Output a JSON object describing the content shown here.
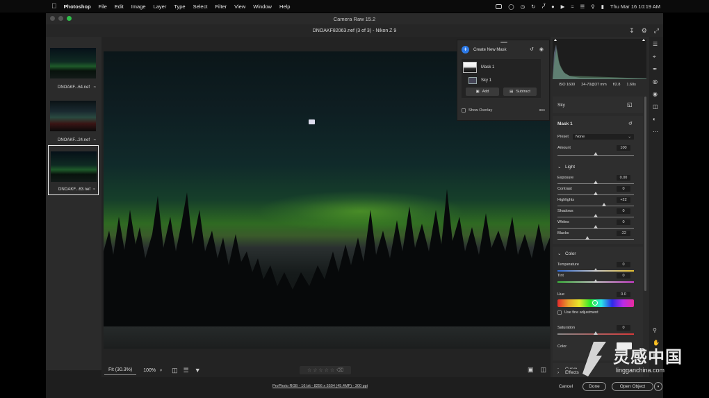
{
  "menubar": {
    "app": "Photoshop",
    "items": [
      "File",
      "Edit",
      "Image",
      "Layer",
      "Type",
      "Select",
      "Filter",
      "View",
      "Window",
      "Help"
    ],
    "datetime": "Thu Mar 16  10:19 AM"
  },
  "window": {
    "title": "Camera Raw 15.2",
    "file_title": "DNOAKF82063.nef (3 of 3)  -  Nikon Z 9"
  },
  "filmstrip": [
    {
      "name": "DNOAKF...64.nef",
      "stack": "≈"
    },
    {
      "name": "DNOAKF...24.nef",
      "stack": "≈"
    },
    {
      "name": "DNOAKF...63.nef",
      "stack": "≈"
    }
  ],
  "mask_panel": {
    "create_label": "Create New Mask",
    "mask_name": "Mask 1",
    "sub_name": "Sky 1",
    "add_label": "Add",
    "subtract_label": "Subtract",
    "overlay_label": "Show Overlay"
  },
  "toolbar": {
    "fit_label": "Fit (30.3%)",
    "zoom_label": "100%",
    "rating": "☆ ☆ ☆ ☆ ☆"
  },
  "status": {
    "info": "ProPhoto RGB - 16 bit - 8256 x 5504 (45.4MP) - 300 ppi"
  },
  "camera": {
    "iso": "ISO 1600",
    "lens": "24-70@37 mm",
    "aperture": "f/2.8",
    "shutter": "1.60s"
  },
  "panel": {
    "sky_label": "Sky",
    "mask_title": "Mask 1",
    "preset_label": "Preset",
    "preset_value": "None",
    "amount_label": "Amount",
    "amount_value": "100",
    "light_title": "Light",
    "light": [
      {
        "label": "Exposure",
        "value": "0.00",
        "pos": 0.5
      },
      {
        "label": "Contrast",
        "value": "0",
        "pos": 0.5
      },
      {
        "label": "Highlights",
        "value": "+22",
        "pos": 0.61
      },
      {
        "label": "Shadows",
        "value": "0",
        "pos": 0.5
      },
      {
        "label": "Whites",
        "value": "0",
        "pos": 0.5
      },
      {
        "label": "Blacks",
        "value": "-22",
        "pos": 0.39
      }
    ],
    "color_title": "Color",
    "temperature_label": "Temperature",
    "temperature_value": "0",
    "tint_label": "Tint",
    "tint_value": "0",
    "hue_label": "Hue",
    "hue_value": "0.0",
    "fine_label": "Use fine adjustment",
    "saturation_label": "Saturation",
    "saturation_value": "0",
    "color_swatch_label": "Color",
    "curve_title": "Curve",
    "effects_title": "Effects"
  },
  "dialog": {
    "cancel": "Cancel",
    "done": "Done",
    "open": "Open Object"
  },
  "watermark": {
    "text": "灵感中国",
    "url": "lingganchina.com"
  },
  "colors": {
    "accent": "#2d7ae8",
    "aurora": "#78d228"
  }
}
